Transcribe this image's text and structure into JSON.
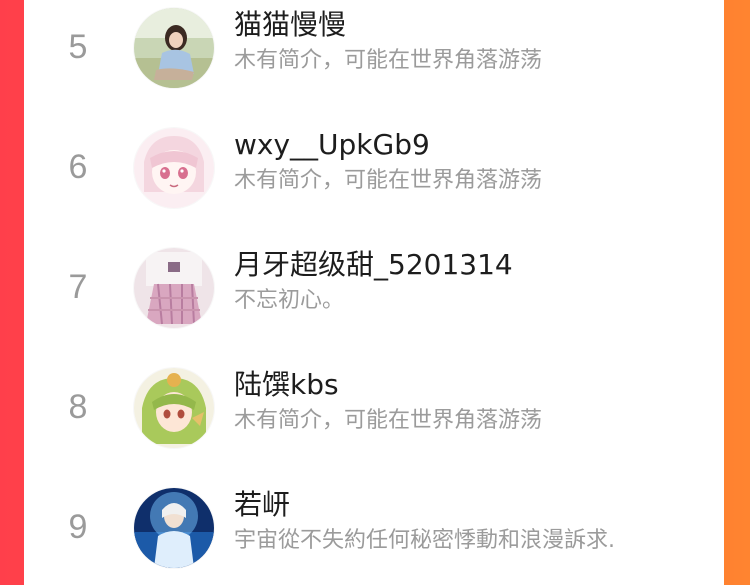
{
  "page": {
    "accent_left": "#ff3f4b",
    "accent_right": "#ff8430"
  },
  "rows": [
    {
      "rank": "5",
      "name": "猫猫慢慢",
      "bio": "木有简介，可能在世界角落游荡",
      "avatar_icon": "avatar-photo-girl-sitting"
    },
    {
      "rank": "6",
      "name": "wxy__UpkGb9",
      "bio": "木有简介，可能在世界角落游荡",
      "avatar_icon": "avatar-anime-pink-hair"
    },
    {
      "rank": "7",
      "name": "月牙超级甜_5201314",
      "bio": "不忘初心。",
      "avatar_icon": "avatar-photo-plaid-skirt"
    },
    {
      "rank": "8",
      "name": "陆馔kbs",
      "bio": "木有简介，可能在世界角落游荡",
      "avatar_icon": "avatar-anime-green-hair"
    },
    {
      "rank": "9",
      "name": "若岍",
      "bio": "宇宙從不失約任何秘密悸動和浪漫訴求.",
      "avatar_icon": "avatar-photo-blue-glow"
    }
  ]
}
